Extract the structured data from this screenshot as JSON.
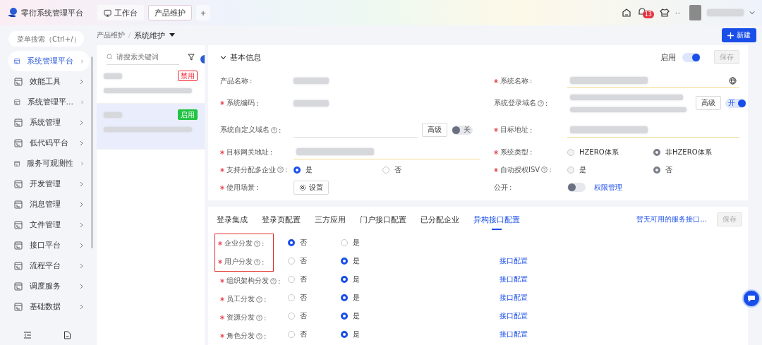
{
  "header": {
    "app_title": "零衍系统管理平台",
    "tabs": [
      {
        "label": "工作台",
        "selected": false
      },
      {
        "label": "产品维护",
        "selected": true
      }
    ],
    "add": "+",
    "notification_count": "13",
    "more": "··"
  },
  "sidebar": {
    "search_placeholder": "菜单搜索（Ctrl+/）",
    "items": [
      {
        "label": "系统管理平台",
        "selected": true
      },
      {
        "label": "效能工具",
        "selected": false
      },
      {
        "label": "系统管理平...",
        "selected": false
      },
      {
        "label": "系统管理",
        "selected": false
      },
      {
        "label": "低代码平台",
        "selected": false
      },
      {
        "label": "服务可观测性",
        "selected": false
      },
      {
        "label": "开发管理",
        "selected": false
      },
      {
        "label": "消息管理",
        "selected": false
      },
      {
        "label": "文件管理",
        "selected": false
      },
      {
        "label": "接口平台",
        "selected": false
      },
      {
        "label": "流程平台",
        "selected": false
      },
      {
        "label": "调度服务",
        "selected": false
      },
      {
        "label": "基础数据",
        "selected": false
      }
    ]
  },
  "breadcrumb": {
    "parent": "产品维护",
    "current": "系统维护"
  },
  "new_button": "新建",
  "list": {
    "search_placeholder": "请搜索关键词",
    "items": [
      {
        "status": "禁用",
        "color": "#f5222d",
        "selected": false
      },
      {
        "status": "启用",
        "color": "#23c343",
        "selected": true
      }
    ]
  },
  "basic_info": {
    "title": "基本信息",
    "expanded": true,
    "enabled_label": "启用",
    "enabled": true,
    "save": "保存",
    "rows": [
      {
        "left": {
          "label": "产品名称",
          "colon": ":",
          "required": false,
          "help": false,
          "kind": "blur"
        },
        "right": {
          "label": "系统名称",
          "colon": ":",
          "required": true,
          "help": false,
          "kind": "input",
          "filled": true,
          "translatable": true
        }
      },
      {
        "left": {
          "label": "系统编码",
          "colon": ":",
          "required": true,
          "help": false,
          "kind": "blur"
        },
        "right": {
          "label": "系统登录域名",
          "colon": ":",
          "required": false,
          "help": true,
          "kind": "domain",
          "filled": true,
          "advanced": "高级",
          "toggle": {
            "label": "开",
            "on": true
          }
        }
      },
      {
        "left": {
          "label": "系统自定义域名",
          "colon": ":",
          "required": false,
          "help": true,
          "kind": "domain",
          "filled": false,
          "advanced": "高级",
          "toggle": {
            "label": "关",
            "on": false
          }
        },
        "right": {
          "label": "目标地址",
          "colon": ":",
          "required": true,
          "help": false,
          "kind": "input",
          "filled": true,
          "translatable": false
        }
      },
      {
        "left": {
          "label": "目标网关地址",
          "colon": ":",
          "required": true,
          "help": false,
          "kind": "input",
          "filled": true,
          "translatable": false
        },
        "right": {
          "label": "系统类型",
          "colon": ":",
          "required": true,
          "help": false,
          "kind": "radio",
          "disabled": true,
          "options": [
            {
              "label": "HZERO体系",
              "selected": false
            },
            {
              "label": "非HZERO体系",
              "selected": true
            }
          ]
        }
      },
      {
        "left": {
          "label": "支持分配多企业",
          "colon": ":",
          "required": true,
          "help": true,
          "kind": "radio",
          "disabled": false,
          "options": [
            {
              "label": "是",
              "selected": true
            },
            {
              "label": "否",
              "selected": false
            }
          ]
        },
        "right": {
          "label": "自动授权ISV",
          "colon": ":",
          "required": true,
          "help": true,
          "kind": "radio",
          "disabled": true,
          "options": [
            {
              "label": "是",
              "selected": false
            },
            {
              "label": "否",
              "selected": true
            }
          ]
        }
      },
      {
        "left": {
          "label": "使用场景",
          "colon": ":",
          "required": true,
          "help": false,
          "kind": "button",
          "button": "设置"
        },
        "right": {
          "label": "公开",
          "colon": ":",
          "required": false,
          "help": false,
          "kind": "switch",
          "on": false,
          "link": "权限管理"
        }
      }
    ]
  },
  "config": {
    "tabs": [
      {
        "label": "登录集成",
        "selected": false
      },
      {
        "label": "登录页配置",
        "selected": false
      },
      {
        "label": "三方应用",
        "selected": false
      },
      {
        "label": "门户接口配置",
        "selected": false
      },
      {
        "label": "已分配企业",
        "selected": false
      },
      {
        "label": "异构接口配置",
        "selected": true
      }
    ],
    "notice_link": "暂无可用的服务接口...",
    "save": "保存",
    "save_disabled": true,
    "rows": [
      {
        "label": "企业分发",
        "colon": ":",
        "required": true,
        "help": true,
        "highlighted": true,
        "options": [
          {
            "label": "否",
            "selected": true
          },
          {
            "label": "是",
            "selected": false
          }
        ]
      },
      {
        "label": "用户分发",
        "colon": ":",
        "required": true,
        "help": true,
        "highlighted": true,
        "options": [
          {
            "label": "否",
            "selected": false
          },
          {
            "label": "是",
            "selected": true
          }
        ],
        "link": "接口配置"
      },
      {
        "label": "组织架构分发",
        "colon": ":",
        "required": true,
        "help": true,
        "highlighted": false,
        "options": [
          {
            "label": "否",
            "selected": false
          },
          {
            "label": "是",
            "selected": true
          }
        ],
        "link": "接口配置"
      },
      {
        "label": "员工分发",
        "colon": ":",
        "required": true,
        "help": true,
        "highlighted": false,
        "options": [
          {
            "label": "否",
            "selected": false
          },
          {
            "label": "是",
            "selected": true
          }
        ],
        "link": "接口配置"
      },
      {
        "label": "资源分发",
        "colon": ":",
        "required": true,
        "help": true,
        "highlighted": false,
        "options": [
          {
            "label": "否",
            "selected": false
          },
          {
            "label": "是",
            "selected": true
          }
        ],
        "link": "接口配置"
      },
      {
        "label": "角色分发",
        "colon": ":",
        "required": true,
        "help": true,
        "highlighted": false,
        "options": [
          {
            "label": "否",
            "selected": false
          },
          {
            "label": "是",
            "selected": true
          }
        ],
        "link": "接口配置"
      }
    ]
  }
}
